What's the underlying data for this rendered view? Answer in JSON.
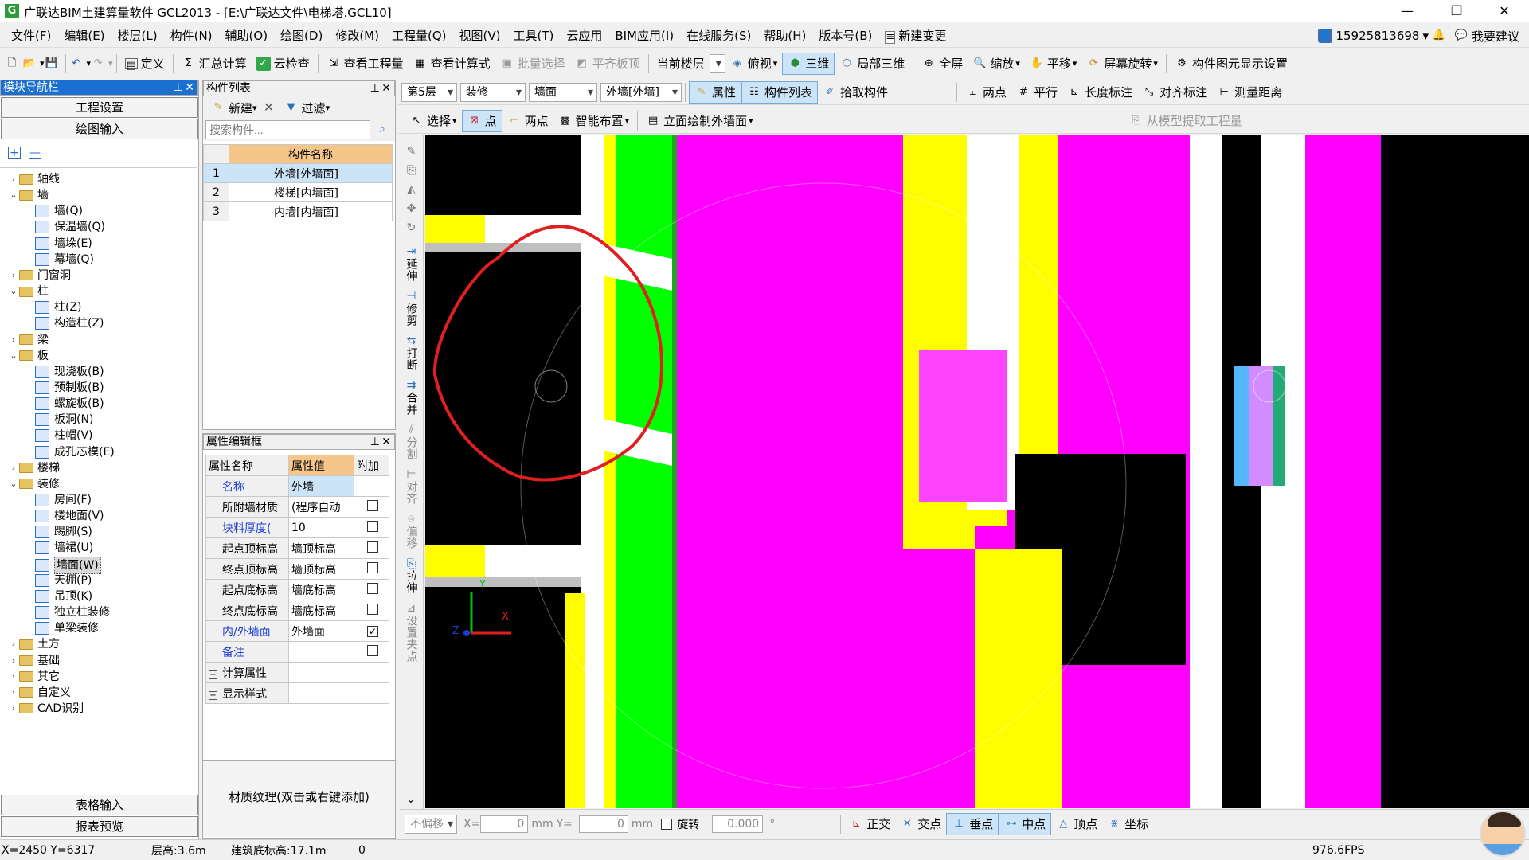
{
  "titlebar": {
    "title": "广联达BIM土建算量软件 GCL2013 - [E:\\广联达文件\\电梯塔.GCL10]",
    "min": "—",
    "max": "❐",
    "close": "✕"
  },
  "menu": [
    "文件(F)",
    "编辑(E)",
    "楼层(L)",
    "构件(N)",
    "辅助(O)",
    "绘图(D)",
    "修改(M)",
    "工程量(Q)",
    "视图(V)",
    "工具(T)",
    "云应用",
    "BIM应用(I)",
    "在线服务(S)",
    "帮助(H)",
    "版本号(B)",
    "新建变更"
  ],
  "account": {
    "phone": "15925813698",
    "suggest": "我要建议"
  },
  "toolbar1": {
    "define": "定义",
    "sum_calc": "汇总计算",
    "cloud_check": "云检查",
    "view_quantity": "查看工程量",
    "view_formula": "查看计算式",
    "batch_select": "批量选择",
    "flat_board": "平齐板顶",
    "current_floor": "当前楼层",
    "top_view": "俯视",
    "three_d": "三维",
    "local_3d": "局部三维",
    "full_screen": "全屏",
    "zoom": "缩放",
    "pan": "平移",
    "rotate": "屏幕旋转",
    "display_settings": "构件图元显示设置"
  },
  "toolbar2": {
    "floor": "第5层",
    "category": "装修",
    "type": "墙面",
    "component": "外墙[外墙]",
    "props": "属性",
    "comp_list": "构件列表",
    "pick": "拾取构件",
    "two_point": "两点",
    "parallel": "平行",
    "length_dim": "长度标注",
    "align_dim": "对齐标注",
    "measure": "测量距离"
  },
  "toolbar3": {
    "select": "选择",
    "point": "点",
    "two_point": "两点",
    "smart_layout": "智能布置",
    "elevation_wall": "立面绘制外墙面",
    "extract": "从模型提取工程量"
  },
  "nav": {
    "title": "模块导航栏",
    "project_settings": "工程设置",
    "draw_input": "绘图输入",
    "expand": "+",
    "collapse": "—",
    "tree": [
      {
        "label": "轴线",
        "level": 0,
        "exp": "›"
      },
      {
        "label": "墙",
        "level": 0,
        "exp": "⌄"
      },
      {
        "label": "墙(Q)",
        "level": 1
      },
      {
        "label": "保温墙(Q)",
        "level": 1
      },
      {
        "label": "墙垛(E)",
        "level": 1
      },
      {
        "label": "幕墙(Q)",
        "level": 1
      },
      {
        "label": "门窗洞",
        "level": 0,
        "exp": "›"
      },
      {
        "label": "柱",
        "level": 0,
        "exp": "⌄"
      },
      {
        "label": "柱(Z)",
        "level": 1
      },
      {
        "label": "构造柱(Z)",
        "level": 1
      },
      {
        "label": "梁",
        "level": 0,
        "exp": "›"
      },
      {
        "label": "板",
        "level": 0,
        "exp": "⌄"
      },
      {
        "label": "现浇板(B)",
        "level": 1
      },
      {
        "label": "预制板(B)",
        "level": 1
      },
      {
        "label": "螺旋板(B)",
        "level": 1
      },
      {
        "label": "板洞(N)",
        "level": 1
      },
      {
        "label": "柱帽(V)",
        "level": 1
      },
      {
        "label": "成孔芯模(E)",
        "level": 1
      },
      {
        "label": "楼梯",
        "level": 0,
        "exp": "›"
      },
      {
        "label": "装修",
        "level": 0,
        "exp": "⌄"
      },
      {
        "label": "房间(F)",
        "level": 1
      },
      {
        "label": "楼地面(V)",
        "level": 1
      },
      {
        "label": "踢脚(S)",
        "level": 1
      },
      {
        "label": "墙裙(U)",
        "level": 1
      },
      {
        "label": "墙面(W)",
        "level": 1,
        "selected": true
      },
      {
        "label": "天棚(P)",
        "level": 1
      },
      {
        "label": "吊顶(K)",
        "level": 1
      },
      {
        "label": "独立柱装修",
        "level": 1
      },
      {
        "label": "单梁装修",
        "level": 1
      },
      {
        "label": "土方",
        "level": 0,
        "exp": "›"
      },
      {
        "label": "基础",
        "level": 0,
        "exp": "›"
      },
      {
        "label": "其它",
        "level": 0,
        "exp": "›"
      },
      {
        "label": "自定义",
        "level": 0,
        "exp": "›"
      },
      {
        "label": "CAD识别",
        "level": 0,
        "exp": "›"
      }
    ],
    "table_input": "表格输入",
    "report_preview": "报表预览"
  },
  "comp_list": {
    "title": "构件列表",
    "new": "新建",
    "filter": "过滤",
    "search_placeholder": "搜索构件...",
    "col_name": "构件名称",
    "rows": [
      {
        "n": "1",
        "name": "外墙[外墙面]"
      },
      {
        "n": "2",
        "name": "楼梯[内墙面]"
      },
      {
        "n": "3",
        "name": "内墙[内墙面]"
      }
    ]
  },
  "props": {
    "title": "属性编辑框",
    "h_name": "属性名称",
    "h_value": "属性值",
    "h_extra": "附加",
    "rows": [
      {
        "name": "名称",
        "value": "外墙",
        "blue": true,
        "check": null
      },
      {
        "name": "所附墙材质",
        "value": "(程序自动",
        "blue": false,
        "check": ""
      },
      {
        "name": "块料厚度(",
        "value": "10",
        "blue": true,
        "check": ""
      },
      {
        "name": "起点顶标高",
        "value": "墙顶标高",
        "blue": false,
        "check": ""
      },
      {
        "name": "终点顶标高",
        "value": "墙顶标高",
        "blue": false,
        "check": ""
      },
      {
        "name": "起点底标高",
        "value": "墙底标高",
        "blue": false,
        "check": ""
      },
      {
        "name": "终点底标高",
        "value": "墙底标高",
        "blue": false,
        "check": ""
      },
      {
        "name": "内/外墙面",
        "value": "外墙面",
        "blue": true,
        "check": "✓"
      },
      {
        "name": "备注",
        "value": "",
        "blue": true,
        "check": ""
      },
      {
        "name": "计算属性",
        "value": "",
        "blue": false,
        "check": null,
        "group": true
      },
      {
        "name": "显示样式",
        "value": "",
        "blue": false,
        "check": null,
        "group": true
      }
    ],
    "texture": "材质纹理(双击或右键添加)"
  },
  "vtools": [
    "延伸",
    "修剪",
    "打断",
    "合并",
    "分割",
    "对齐",
    "偏移",
    "拉伸",
    "设置夹点"
  ],
  "bottom": {
    "no_offset": "不偏移",
    "x_label": "X=",
    "x_val": "0",
    "mm": "mm",
    "y_label": "Y=",
    "y_val": "0",
    "rotate": "旋转",
    "angle": "0.000",
    "deg": "°",
    "ortho": "正交",
    "intersect": "交点",
    "perp": "垂点",
    "mid": "中点",
    "vertex": "顶点",
    "coord": "坐标"
  },
  "status": {
    "coords": "X=2450 Y=6317",
    "floor_height": "层高:3.6m",
    "base_elev": "建筑底标高:17.1m",
    "zero": "0",
    "fps": "976.6FPS"
  },
  "axis": {
    "y": "Y",
    "x": "X",
    "z": "Z"
  },
  "colors": {
    "viewport_bg": "#000000",
    "magenta": "#ff00ff",
    "green": "#00ff00",
    "yellow": "#ffff00",
    "annotation_red": "#e02020",
    "title_active": "#1a6fd1"
  }
}
